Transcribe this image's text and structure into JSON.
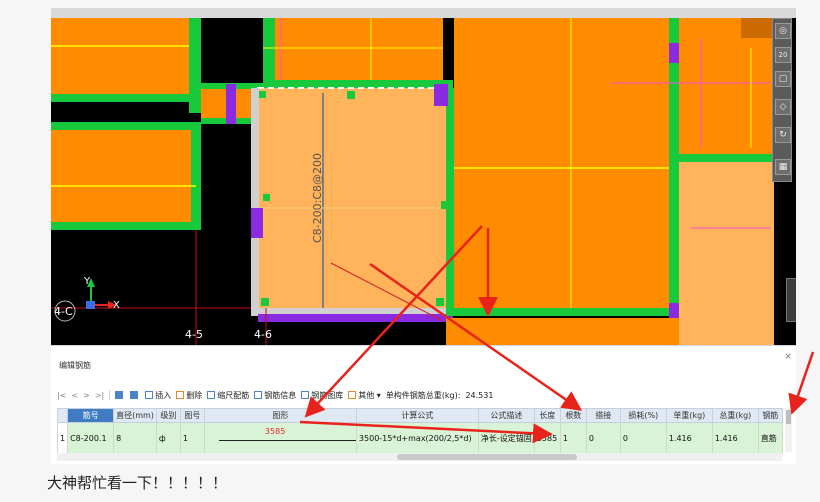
{
  "cad": {
    "labels": {
      "rebar_annotation": "C8-200:C8@200",
      "axis_y": "Y",
      "axis_x": "X",
      "grid_row": "4-C",
      "grid_col_1": "4-5",
      "grid_col_2": "4-6"
    },
    "nav_cube": {
      "zoom_label": "20"
    },
    "colors": {
      "background": "#000000",
      "slab_orange": "#ff8c00",
      "slab_light": "#ffb35a",
      "beam_green": "#19c93c",
      "column_purple": "#8a2be2",
      "line_yellow": "#ffff00",
      "line_magenta": "#ff4dd2",
      "arrow_red": "#e8231b"
    }
  },
  "panel": {
    "title": "编辑钢筋",
    "close_label": "×",
    "toolbar": {
      "nav": [
        "|<",
        "<",
        ">",
        ">|"
      ],
      "insert": "插入",
      "delete": "删除",
      "scale_rebar": "缩尺配筋",
      "rebar_info": "钢筋信息",
      "rebar_library": "钢筋图库",
      "other": "其他",
      "other_arrow": "▾",
      "total_weight_label": "单构件钢筋总重(kg):",
      "total_weight_value": "24.531"
    },
    "columns": [
      "筋号",
      "直径(mm)",
      "级别",
      "图号",
      "图形",
      "计算公式",
      "公式描述",
      "长度",
      "根数",
      "搭接",
      "损耗(%)",
      "单重(kg)",
      "总重(kg)",
      "钢筋"
    ],
    "rows": [
      {
        "row_no": "1",
        "bar_no": "C8-200.1",
        "diameter": "8",
        "grade": "ф",
        "fig_no": "1",
        "shape_value": "3585",
        "formula": "3500-15*d+max(200/2,5*d)",
        "formula_desc": "净长-设定锚固",
        "length": "3585",
        "count": "1",
        "lap": "0",
        "loss": "0",
        "unit_weight": "1.416",
        "total_weight": "1.416",
        "bar_type": "直筋"
      }
    ]
  },
  "caption": "大神帮忙看一下！！！！！"
}
